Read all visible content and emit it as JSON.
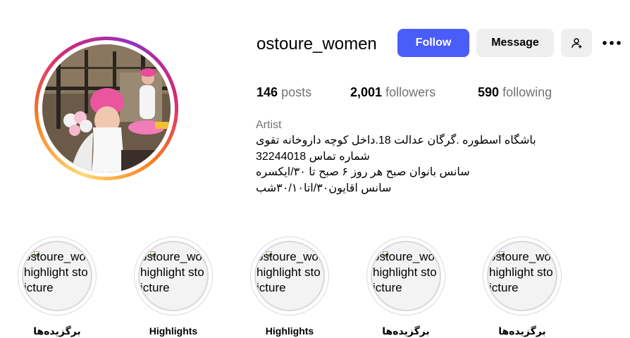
{
  "profile": {
    "username": "ostoure_women",
    "follow_label": "Follow",
    "message_label": "Message",
    "add_user_icon": "person-plus-icon",
    "more_icon": "ellipsis-icon"
  },
  "stats": {
    "posts_count": "146",
    "posts_label": "posts",
    "followers_count": "2,001",
    "followers_label": "followers",
    "following_count": "590",
    "following_label": "following"
  },
  "bio": {
    "category": "Artist",
    "lines": [
      "باشگاه اسطوره .گرگان عدالت 18.داخل کوچه داروخانه تقوی",
      "شماره تماس 32244018",
      "سانس بانوان صبح هر روز ۶ صبح تا ۳۰/ایکسره",
      "سانس اقایون۳۰/اتا۳۰/۱۰شب"
    ]
  },
  "highlights": [
    {
      "label": "برگزیده‌ها",
      "alt_lines": [
        "ostoure_wor",
        "highlight sto",
        "icture"
      ]
    },
    {
      "label": "Highlights",
      "alt_lines": [
        "ostoure_wor",
        "highlight sto",
        "icture"
      ]
    },
    {
      "label": "Highlights",
      "alt_lines": [
        "ostoure_wor",
        "highlight sto",
        "icture"
      ]
    },
    {
      "label": "برگزیده‌ها",
      "alt_lines": [
        "ostoure_wor",
        "highlight sto",
        "icture"
      ]
    },
    {
      "label": "برگزیده‌ها",
      "alt_lines": [
        "ostoure_wor",
        "highlight sto",
        "icture"
      ]
    }
  ],
  "colors": {
    "follow_button": "#4a5df9",
    "secondary_button": "#efefef",
    "muted_text": "#737373",
    "story_ring": [
      "#feda75",
      "#fa7e1e",
      "#d62976",
      "#962fbf"
    ]
  }
}
